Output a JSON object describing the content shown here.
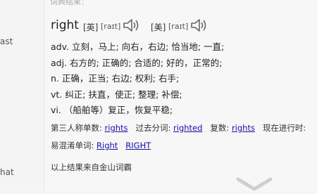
{
  "sidebar": {
    "fragment_top": "ast",
    "fragment_bottom": "hat"
  },
  "result": {
    "header": "词典结果：",
    "word": "right",
    "phonetics": [
      {
        "label": "[英]",
        "ipa": "[raɪt]",
        "icon": "speaker-icon"
      },
      {
        "label": "[美]",
        "ipa": "[raɪt]",
        "icon": "speaker-icon"
      }
    ],
    "definitions": [
      {
        "pos": "adv.",
        "text": "立刻，马上; 向右，右边; 恰当地; 一直;"
      },
      {
        "pos": "adj.",
        "text": "右方的; 正确的; 合适的; 好的，正常的;"
      },
      {
        "pos": "n.",
        "text": "正确，正当; 右边; 权利; 右手;"
      },
      {
        "pos": "vt.",
        "text": "纠正; 扶直，使正; 整理; 补偿;"
      },
      {
        "pos": "vi.",
        "text": "（船舶等）复正，恢复平稳;"
      }
    ],
    "forms": {
      "third_person_label": "第三人称单数:",
      "third_person": "rights",
      "past_participle_label": "过去分词:",
      "past_participle": "righted",
      "plural_label": "复数:",
      "plural": "rights",
      "present_participle_label": "现在进行时:"
    },
    "confusables_label": "易混淆单词:",
    "confusables": [
      "Right",
      "RIGHT"
    ],
    "source": "以上结果来自金山词霸",
    "expand_icon": "chevron-down-icon"
  }
}
